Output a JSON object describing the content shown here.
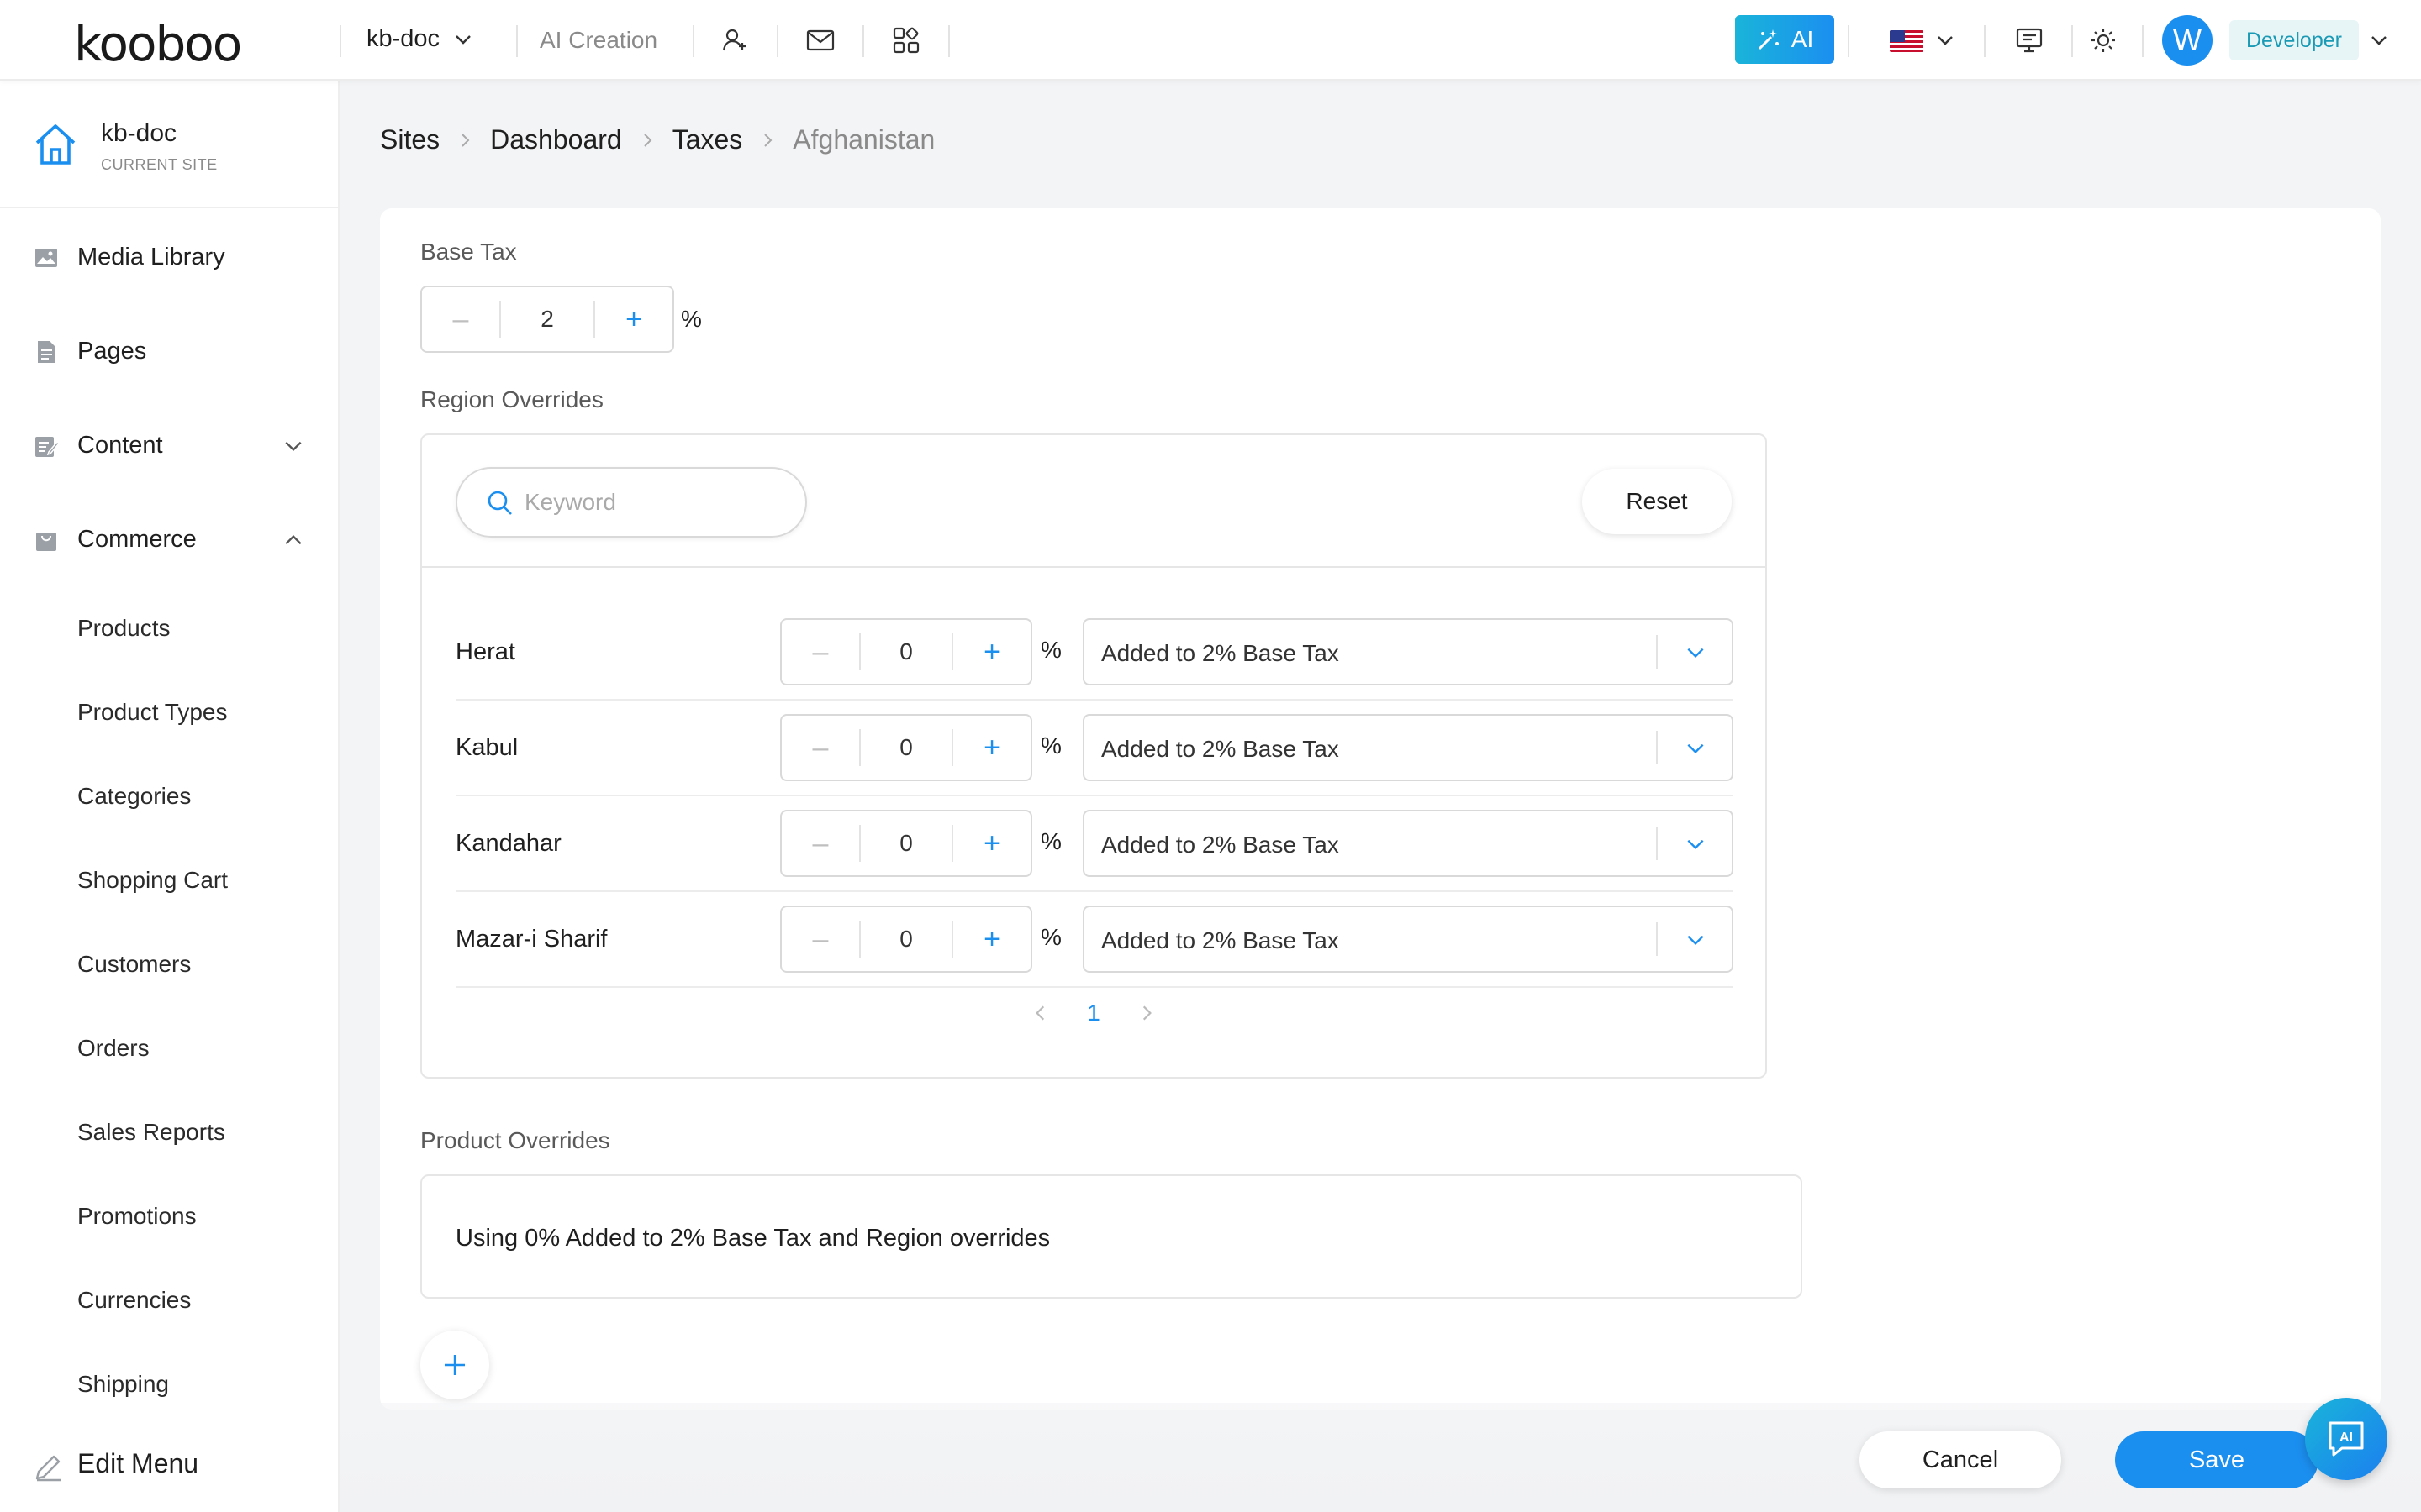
{
  "header": {
    "logo": "kooboo",
    "site_switch": "kb-doc",
    "ai_creation": "AI Creation",
    "ai_button": "AI",
    "avatar_initial": "W",
    "role": "Developer",
    "accent_color": "#1b8ff0",
    "icons": [
      "user-group-icon",
      "mail-icon",
      "apps-grid-icon",
      "us-flag-icon",
      "monitor-icon",
      "sun-icon"
    ]
  },
  "sidebar": {
    "current_site": {
      "name": "kb-doc",
      "label": "CURRENT SITE"
    },
    "items": [
      {
        "label": "Media Library",
        "icon": "image-icon"
      },
      {
        "label": "Pages",
        "icon": "page-icon"
      },
      {
        "label": "Content",
        "icon": "content-icon",
        "expanded": false
      },
      {
        "label": "Commerce",
        "icon": "bag-icon",
        "expanded": true
      }
    ],
    "commerce_items": [
      "Products",
      "Product Types",
      "Categories",
      "Shopping Cart",
      "Customers",
      "Orders",
      "Sales Reports",
      "Promotions",
      "Currencies",
      "Shipping"
    ],
    "edit_menu": "Edit Menu"
  },
  "breadcrumb": [
    "Sites",
    "Dashboard",
    "Taxes",
    "Afghanistan"
  ],
  "base_tax": {
    "label": "Base Tax",
    "value": "2",
    "unit": "%"
  },
  "region_overrides": {
    "label": "Region Overrides",
    "search_placeholder": "Keyword",
    "reset_label": "Reset",
    "rows": [
      {
        "name": "Herat",
        "value": "0",
        "unit": "%",
        "mode": "Added to 2% Base Tax"
      },
      {
        "name": "Kabul",
        "value": "0",
        "unit": "%",
        "mode": "Added to 2% Base Tax"
      },
      {
        "name": "Kandahar",
        "value": "0",
        "unit": "%",
        "mode": "Added to 2% Base Tax"
      },
      {
        "name": "Mazar-i Sharif",
        "value": "0",
        "unit": "%",
        "mode": "Added to 2% Base Tax"
      }
    ],
    "page": "1"
  },
  "product_overrides": {
    "label": "Product Overrides",
    "text": "Using 0% Added to 2% Base Tax and Region overrides"
  },
  "footer": {
    "cancel": "Cancel",
    "save": "Save",
    "chat_fab": "AI"
  }
}
